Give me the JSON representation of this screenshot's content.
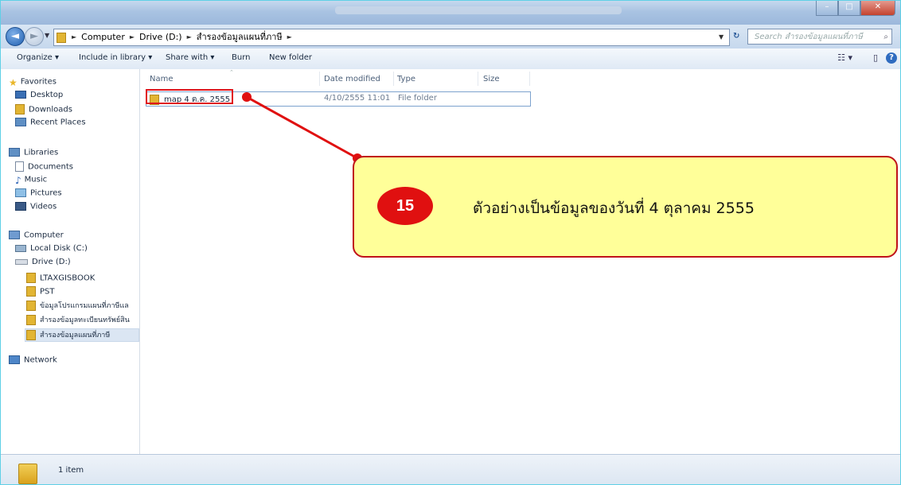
{
  "window": {
    "nav": {
      "back_glyph": "◄",
      "forward_glyph": "►"
    },
    "address": {
      "crumbs": [
        "Computer",
        "Drive (D:)",
        "สำรองข้อมูลแผนที่ภาษี"
      ],
      "separator": "►"
    },
    "search": {
      "placeholder": "Search สำรองข้อมูลแผนที่ภาษี"
    }
  },
  "toolbar": {
    "organize": "Organize ▾",
    "include_in_library": "Include in library ▾",
    "share_with": "Share with ▾",
    "burn": "Burn",
    "new_folder": "New folder"
  },
  "sidebar": {
    "favorites": "Favorites",
    "desktop": "Desktop",
    "downloads": "Downloads",
    "recent_places": "Recent Places",
    "libraries": "Libraries",
    "documents": "Documents",
    "music": "Music",
    "pictures": "Pictures",
    "videos": "Videos",
    "computer": "Computer",
    "local_disk": "Local Disk (C:)",
    "drive_d": "Drive (D:)",
    "folder_1": "LTAXGISBOOK",
    "folder_2": "PST",
    "folder_3": "ข้อมูลโปรแกรมแผนที่ภาษีแล",
    "folder_4": "สำรองข้อมูลทะเบียนทรัพย์สิน",
    "folder_5": "สำรองข้อมูลแผนที่ภาษี",
    "network": "Network"
  },
  "columns": {
    "name": "Name",
    "date_modified": "Date modified",
    "type": "Type",
    "size": "Size"
  },
  "files": [
    {
      "name": "map 4 ต.ค. 2555",
      "date_modified": "4/10/2555 11:01",
      "type": "File folder",
      "size": ""
    }
  ],
  "status": {
    "item_count": "1 item"
  },
  "annotation": {
    "step": "15",
    "text": "ตัวอย่างเป็นข้อมูลของวันที่ 4 ตุลาคม 2555",
    "color": "#e01010",
    "fill": "#ffff99"
  },
  "colors": {
    "frame": "#5fd0e6",
    "selection": "#dbe6f3"
  }
}
